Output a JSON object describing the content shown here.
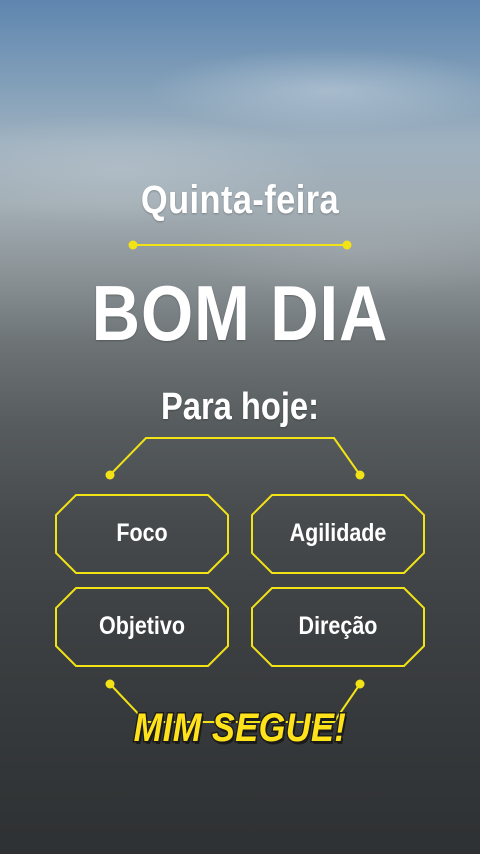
{
  "header": {
    "day": "Quinta-feira",
    "greeting": "BOM DIA",
    "subtitle": "Para hoje:"
  },
  "items": [
    {
      "label": "Foco"
    },
    {
      "label": "Agilidade"
    },
    {
      "label": "Objetivo"
    },
    {
      "label": "Direção"
    }
  ],
  "caption": "MIM SEGUE!",
  "colors": {
    "accent": "#f2e316",
    "caption_fill": "#ffe21a",
    "text": "#ffffff"
  }
}
